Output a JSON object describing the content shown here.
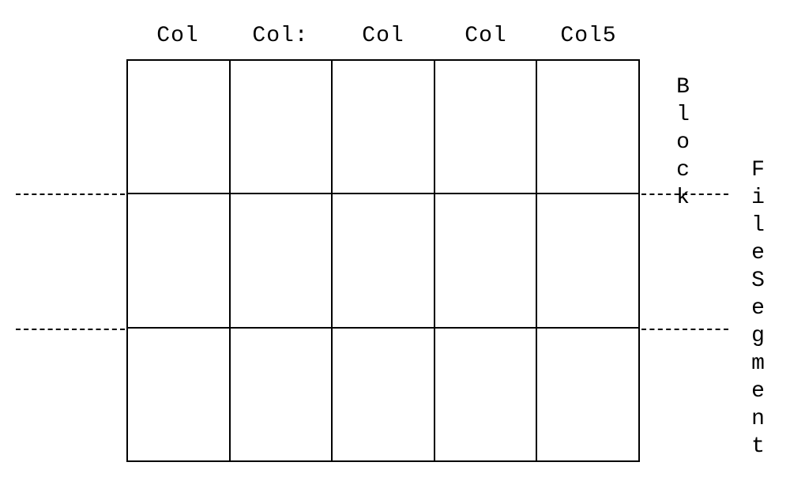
{
  "headers": {
    "col1": "Col",
    "col2": "Col:",
    "col3": "Col",
    "col4": "Col",
    "col5": "Col5"
  },
  "labels": {
    "block": "Block",
    "filesegment": "FileSegment"
  }
}
